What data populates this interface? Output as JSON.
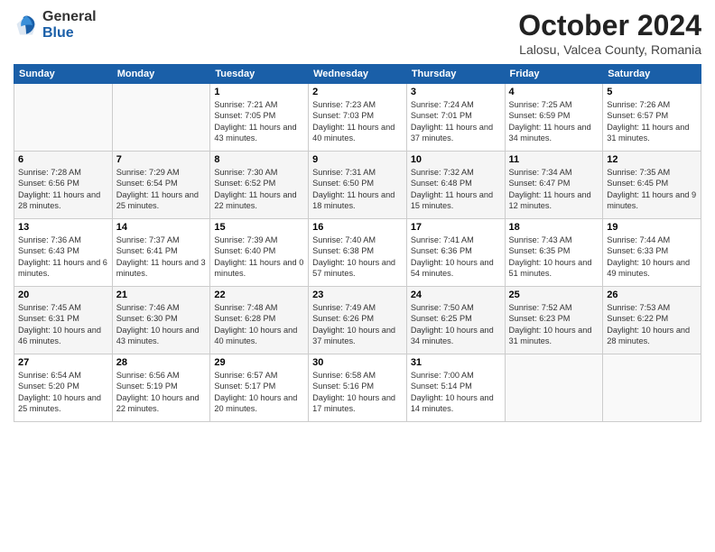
{
  "header": {
    "logo_line1": "General",
    "logo_line2": "Blue",
    "month": "October 2024",
    "location": "Lalosu, Valcea County, Romania"
  },
  "weekdays": [
    "Sunday",
    "Monday",
    "Tuesday",
    "Wednesday",
    "Thursday",
    "Friday",
    "Saturday"
  ],
  "weeks": [
    [
      {
        "day": "",
        "info": ""
      },
      {
        "day": "",
        "info": ""
      },
      {
        "day": "1",
        "info": "Sunrise: 7:21 AM\nSunset: 7:05 PM\nDaylight: 11 hours and 43 minutes."
      },
      {
        "day": "2",
        "info": "Sunrise: 7:23 AM\nSunset: 7:03 PM\nDaylight: 11 hours and 40 minutes."
      },
      {
        "day": "3",
        "info": "Sunrise: 7:24 AM\nSunset: 7:01 PM\nDaylight: 11 hours and 37 minutes."
      },
      {
        "day": "4",
        "info": "Sunrise: 7:25 AM\nSunset: 6:59 PM\nDaylight: 11 hours and 34 minutes."
      },
      {
        "day": "5",
        "info": "Sunrise: 7:26 AM\nSunset: 6:57 PM\nDaylight: 11 hours and 31 minutes."
      }
    ],
    [
      {
        "day": "6",
        "info": "Sunrise: 7:28 AM\nSunset: 6:56 PM\nDaylight: 11 hours and 28 minutes."
      },
      {
        "day": "7",
        "info": "Sunrise: 7:29 AM\nSunset: 6:54 PM\nDaylight: 11 hours and 25 minutes."
      },
      {
        "day": "8",
        "info": "Sunrise: 7:30 AM\nSunset: 6:52 PM\nDaylight: 11 hours and 22 minutes."
      },
      {
        "day": "9",
        "info": "Sunrise: 7:31 AM\nSunset: 6:50 PM\nDaylight: 11 hours and 18 minutes."
      },
      {
        "day": "10",
        "info": "Sunrise: 7:32 AM\nSunset: 6:48 PM\nDaylight: 11 hours and 15 minutes."
      },
      {
        "day": "11",
        "info": "Sunrise: 7:34 AM\nSunset: 6:47 PM\nDaylight: 11 hours and 12 minutes."
      },
      {
        "day": "12",
        "info": "Sunrise: 7:35 AM\nSunset: 6:45 PM\nDaylight: 11 hours and 9 minutes."
      }
    ],
    [
      {
        "day": "13",
        "info": "Sunrise: 7:36 AM\nSunset: 6:43 PM\nDaylight: 11 hours and 6 minutes."
      },
      {
        "day": "14",
        "info": "Sunrise: 7:37 AM\nSunset: 6:41 PM\nDaylight: 11 hours and 3 minutes."
      },
      {
        "day": "15",
        "info": "Sunrise: 7:39 AM\nSunset: 6:40 PM\nDaylight: 11 hours and 0 minutes."
      },
      {
        "day": "16",
        "info": "Sunrise: 7:40 AM\nSunset: 6:38 PM\nDaylight: 10 hours and 57 minutes."
      },
      {
        "day": "17",
        "info": "Sunrise: 7:41 AM\nSunset: 6:36 PM\nDaylight: 10 hours and 54 minutes."
      },
      {
        "day": "18",
        "info": "Sunrise: 7:43 AM\nSunset: 6:35 PM\nDaylight: 10 hours and 51 minutes."
      },
      {
        "day": "19",
        "info": "Sunrise: 7:44 AM\nSunset: 6:33 PM\nDaylight: 10 hours and 49 minutes."
      }
    ],
    [
      {
        "day": "20",
        "info": "Sunrise: 7:45 AM\nSunset: 6:31 PM\nDaylight: 10 hours and 46 minutes."
      },
      {
        "day": "21",
        "info": "Sunrise: 7:46 AM\nSunset: 6:30 PM\nDaylight: 10 hours and 43 minutes."
      },
      {
        "day": "22",
        "info": "Sunrise: 7:48 AM\nSunset: 6:28 PM\nDaylight: 10 hours and 40 minutes."
      },
      {
        "day": "23",
        "info": "Sunrise: 7:49 AM\nSunset: 6:26 PM\nDaylight: 10 hours and 37 minutes."
      },
      {
        "day": "24",
        "info": "Sunrise: 7:50 AM\nSunset: 6:25 PM\nDaylight: 10 hours and 34 minutes."
      },
      {
        "day": "25",
        "info": "Sunrise: 7:52 AM\nSunset: 6:23 PM\nDaylight: 10 hours and 31 minutes."
      },
      {
        "day": "26",
        "info": "Sunrise: 7:53 AM\nSunset: 6:22 PM\nDaylight: 10 hours and 28 minutes."
      }
    ],
    [
      {
        "day": "27",
        "info": "Sunrise: 6:54 AM\nSunset: 5:20 PM\nDaylight: 10 hours and 25 minutes."
      },
      {
        "day": "28",
        "info": "Sunrise: 6:56 AM\nSunset: 5:19 PM\nDaylight: 10 hours and 22 minutes."
      },
      {
        "day": "29",
        "info": "Sunrise: 6:57 AM\nSunset: 5:17 PM\nDaylight: 10 hours and 20 minutes."
      },
      {
        "day": "30",
        "info": "Sunrise: 6:58 AM\nSunset: 5:16 PM\nDaylight: 10 hours and 17 minutes."
      },
      {
        "day": "31",
        "info": "Sunrise: 7:00 AM\nSunset: 5:14 PM\nDaylight: 10 hours and 14 minutes."
      },
      {
        "day": "",
        "info": ""
      },
      {
        "day": "",
        "info": ""
      }
    ]
  ]
}
